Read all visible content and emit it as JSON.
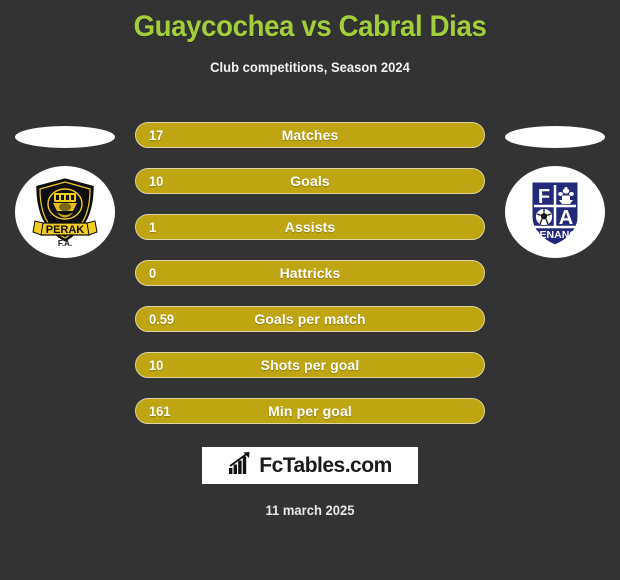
{
  "page": {
    "background_color": "#333333",
    "title": "Guaycochea vs Cabral Dias",
    "title_color": "#a3ce3c",
    "subtitle": "Club competitions, Season 2024",
    "date": "11 march 2025"
  },
  "teams": {
    "home": {
      "name": "PERAK",
      "sub_name": "F.A.",
      "crest_icon": "perak-fa-crest-icon",
      "shield_color": "#0d0d0d",
      "accent_color": "#f2cc1e"
    },
    "away": {
      "name": "PENANG",
      "letter_top_left": "F",
      "letter_bottom_right": "A",
      "crest_icon": "penang-fa-crest-icon",
      "shield_color": "#242a7a",
      "accent_color": "#ffffff"
    }
  },
  "stats": {
    "bar_color": "#c0a512",
    "bar_border_color": "#ddd6a0",
    "rows": [
      {
        "label": "Matches",
        "value": "17"
      },
      {
        "label": "Goals",
        "value": "10"
      },
      {
        "label": "Assists",
        "value": "1"
      },
      {
        "label": "Hattricks",
        "value": "0"
      },
      {
        "label": "Goals per match",
        "value": "0.59"
      },
      {
        "label": "Shots per goal",
        "value": "10"
      },
      {
        "label": "Min per goal",
        "value": "161"
      }
    ]
  },
  "brand": {
    "text": "FcTables.com",
    "icon": "bar-chart-growth-icon",
    "background_color": "#ffffff",
    "text_color": "#1a1a1a"
  },
  "chart_data": {
    "type": "table",
    "title": "Guaycochea vs Cabral Dias",
    "subtitle": "Club competitions, Season 2024",
    "categories": [
      "Matches",
      "Goals",
      "Assists",
      "Hattricks",
      "Goals per match",
      "Shots per goal",
      "Min per goal"
    ],
    "values": [
      17,
      10,
      1,
      0,
      0.59,
      10,
      161
    ],
    "xlabel": "",
    "ylabel": "",
    "legend": [
      "PERAK F.A.",
      "PENANG F.A."
    ],
    "grid": false
  }
}
